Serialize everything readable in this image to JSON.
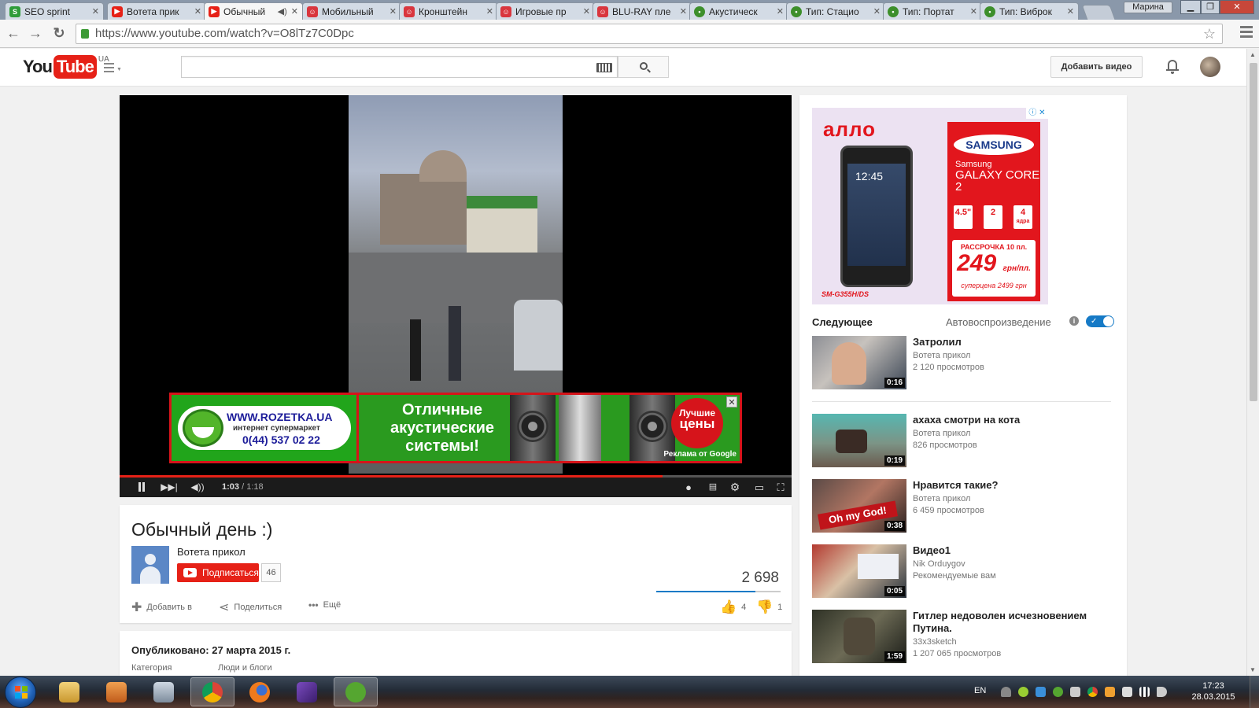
{
  "browser": {
    "tabs": [
      {
        "label": "SEO sprint",
        "favicon": "seosprint-icon",
        "color": "#2f9c3a",
        "active": false
      },
      {
        "label": "Вотета прик",
        "favicon": "youtube-icon",
        "color": "#e62117",
        "active": false
      },
      {
        "label": "Обычный",
        "favicon": "youtube-icon",
        "color": "#e62117",
        "active": true
      },
      {
        "label": "Мобильный",
        "favicon": "rozetka-icon",
        "color": "#d9363e",
        "active": false
      },
      {
        "label": "Кронштейн",
        "favicon": "rozetka-icon",
        "color": "#d9363e",
        "active": false
      },
      {
        "label": "Игровые пр",
        "favicon": "rozetka-icon",
        "color": "#d9363e",
        "active": false
      },
      {
        "label": "BLU-RAY пле",
        "favicon": "rozetka-icon",
        "color": "#d9363e",
        "active": false
      },
      {
        "label": "Акустическ",
        "favicon": "frog-icon",
        "color": "#3d8f2b",
        "active": false
      },
      {
        "label": "Тип: Стацио",
        "favicon": "frog-icon",
        "color": "#3d8f2b",
        "active": false
      },
      {
        "label": "Тип: Портат",
        "favicon": "frog-icon",
        "color": "#3d8f2b",
        "active": false
      },
      {
        "label": "Тип: Виброк",
        "favicon": "frog-icon",
        "color": "#3d8f2b",
        "active": false
      }
    ],
    "user": "Марина",
    "url": "https://www.youtube.com/watch?v=O8lTz7C0Dpc"
  },
  "youtube": {
    "logo_you": "You",
    "logo_tube": "Tube",
    "region": "UA",
    "search_placeholder": "",
    "upload_label": "Добавить видео"
  },
  "player": {
    "overlay_ad": {
      "site": "WWW.ROZETKA.UA",
      "subtitle": "интернет супермаркет",
      "phone": "0(44) 537 02 22",
      "headline": "Отличные акустические системы!",
      "badge_line1": "Лучшие",
      "badge_line2": "цены",
      "by": "Реклама от Google",
      "close": "✕"
    },
    "current_time": "1:03",
    "duration": "/ 1:18",
    "progress_fraction": 0.808
  },
  "video": {
    "title": "Обычный день :)",
    "channel": "Вотета прикол",
    "subscribe_label": "Подписаться",
    "subscriber_count": "46",
    "views": "2 698",
    "like_fraction": 0.8,
    "actions": {
      "add_to": "Добавить в",
      "share": "Поделиться",
      "more": "Ещё"
    },
    "likes": "4",
    "dislikes": "1",
    "published": "Опубликовано: 27 марта 2015 г.",
    "category_label": "Категория",
    "category_value": "Люди и блоги"
  },
  "sidebar_ad": {
    "brand": "алло",
    "phone_clock": "12:45",
    "model": "SM-G355H/DS",
    "maker": "SAMSUNG",
    "series": "Samsung",
    "product": "GALAXY CORE 2",
    "spec1": "4.5\"",
    "spec2": "2",
    "spec3": "4",
    "spec3_note": "ядра",
    "installment": "РАССРОЧКА 10 пл.",
    "price": "249",
    "price_unit": "грн/пл.",
    "full_price": "суперцена 2499 грн",
    "adchoices": "ⓘ ✕"
  },
  "sidebar": {
    "up_next_label": "Следующее",
    "autoplay_label": "Автовоспроизведение",
    "autoplay_on": true,
    "recommendations": [
      {
        "title": "Затролил",
        "channel": "Вотета прикол",
        "meta": "2 120 просмотров",
        "duration": "0:16"
      },
      {
        "title": "ахаха смотри на кота",
        "channel": "Вотета прикол",
        "meta": "826 просмотров",
        "duration": "0:19"
      },
      {
        "title": "Нравится такие?",
        "channel": "Вотета прикол",
        "meta": "6 459 просмотров",
        "duration": "0:38"
      },
      {
        "title": "Видео1",
        "channel": "Nik Orduygov",
        "meta": "Рекомендуемые вам",
        "duration": "0:05"
      },
      {
        "title": "Гитлер недоволен исчезновением Путина.",
        "channel": "33x3sketch",
        "meta": "1 207 065 просмотров",
        "duration": "1:59"
      }
    ]
  },
  "taskbar": {
    "language": "EN",
    "time": "17:23",
    "date": "28.03.2015"
  },
  "colors": {
    "youtube_red": "#e62117",
    "link_blue": "#167ac6",
    "rozetka_green": "#21a51b"
  }
}
